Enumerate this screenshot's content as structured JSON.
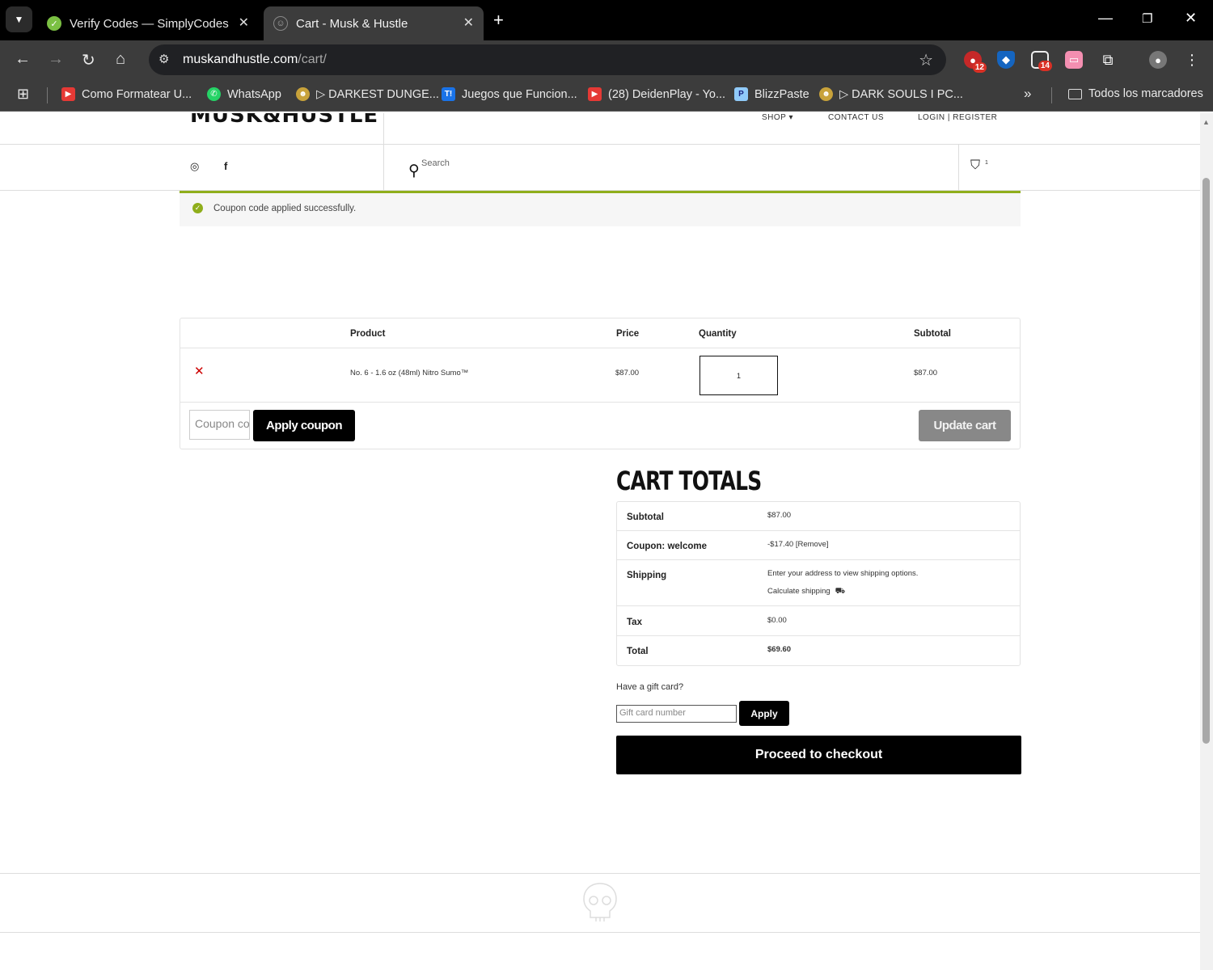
{
  "browser": {
    "tabs": [
      {
        "title": "Verify Codes — SimplyCodes",
        "active": false
      },
      {
        "title": "Cart - Musk & Hustle",
        "active": true
      }
    ],
    "url_domain": "muskandhustle.com",
    "url_path": "/cart/",
    "extension_badges": {
      "first": "12",
      "second": "14"
    },
    "bookmarks": [
      {
        "label": "Como Formatear U...",
        "icon": "youtube-icon"
      },
      {
        "label": "WhatsApp",
        "icon": "whatsapp-icon"
      },
      {
        "label": "▷ DARKEST DUNGE...",
        "icon": "game-icon"
      },
      {
        "label": "Juegos que Funcion...",
        "icon": "t-icon"
      },
      {
        "label": "(28) DeidenPlay - Yo...",
        "icon": "youtube-icon"
      },
      {
        "label": "BlizzPaste",
        "icon": "blizzpaste-icon"
      },
      {
        "label": "▷ DARK SOULS I PC...",
        "icon": "game-icon"
      }
    ],
    "all_bookmarks": "Todos los marcadores",
    "colors": {
      "tabbar": "#000000",
      "toolbar": "#3c3c3c",
      "badge": "#d93025"
    }
  },
  "site": {
    "logo": "MUSK&HUSTLE",
    "nav": {
      "shop": "SHOP ▾",
      "contact": "CONTACT US",
      "login": "LOGIN | REGISTER"
    },
    "search_placeholder": "Search",
    "cart_count": "1"
  },
  "notice": {
    "message": "Coupon code applied successfully.",
    "color": "#8fae1b"
  },
  "cart": {
    "headers": {
      "product": "Product",
      "price": "Price",
      "quantity": "Quantity",
      "subtotal": "Subtotal"
    },
    "items": [
      {
        "name": "No. 6 - 1.6 oz (48ml) Nitro Sumo™",
        "price": "$87.00",
        "quantity": "1",
        "subtotal": "$87.00"
      }
    ],
    "coupon_placeholder": "Coupon code",
    "apply_coupon": "Apply coupon",
    "update_cart": "Update cart"
  },
  "totals": {
    "title": "CART TOTALS",
    "subtotal_label": "Subtotal",
    "subtotal_value": "$87.00",
    "coupon_label": "Coupon: welcome",
    "coupon_value": "-$17.40 [Remove]",
    "shipping_label": "Shipping",
    "shipping_note": "Enter your address to view shipping options.",
    "calculate_shipping": "Calculate shipping",
    "tax_label": "Tax",
    "tax_value": "$0.00",
    "total_label": "Total",
    "total_value": "$69.60"
  },
  "gift": {
    "question": "Have a gift card?",
    "placeholder": "Gift card number",
    "apply": "Apply"
  },
  "checkout": "Proceed to checkout"
}
